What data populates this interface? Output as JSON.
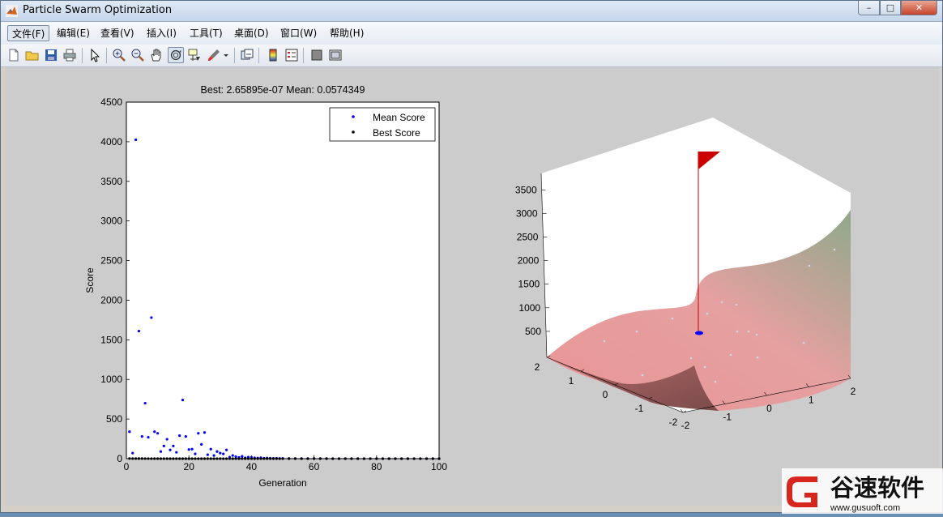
{
  "window": {
    "title": "Particle Swarm Optimization",
    "controls": {
      "minimize": "–",
      "maximize": "□",
      "close": "✕"
    }
  },
  "menubar": {
    "items": [
      {
        "label": "文件(F)"
      },
      {
        "label": "编辑(E)"
      },
      {
        "label": "查看(V)"
      },
      {
        "label": "插入(I)"
      },
      {
        "label": "工具(T)"
      },
      {
        "label": "桌面(D)"
      },
      {
        "label": "窗口(W)"
      },
      {
        "label": "帮助(H)"
      }
    ],
    "dock_icon": "dock-arrow-icon"
  },
  "toolbar": {
    "icons": [
      "new-file-icon",
      "open-folder-icon",
      "save-icon",
      "print-icon",
      "select-arrow-icon",
      "zoom-in-icon",
      "zoom-out-icon",
      "pan-hand-icon",
      "rotate-3d-icon",
      "data-cursor-icon",
      "brush-icon",
      "brush-menu-icon",
      "link-plot-icon",
      "colorbar-icon",
      "legend-icon",
      "hide-plot-tools-icon",
      "show-plot-tools-icon"
    ]
  },
  "chart_data": [
    {
      "type": "scatter",
      "title": "Best: 2.65895e-07 Mean: 0.0574349",
      "xlabel": "Generation",
      "ylabel": "Score",
      "xlim": [
        0,
        100
      ],
      "ylim": [
        0,
        4500
      ],
      "xticks": [
        "0",
        "20",
        "40",
        "60",
        "80",
        "100"
      ],
      "yticks": [
        "0",
        "500",
        "1000",
        "1500",
        "2000",
        "2500",
        "3000",
        "3500",
        "4000",
        "4500"
      ],
      "legend_position": "top-right",
      "series": [
        {
          "name": "Mean Score",
          "color": "#0000ff",
          "x": [
            1,
            2,
            3,
            4,
            5,
            6,
            7,
            8,
            9,
            10,
            11,
            12,
            13,
            14,
            15,
            16,
            17,
            18,
            19,
            20,
            21,
            22,
            23,
            24,
            25,
            26,
            27,
            28,
            29,
            30,
            31,
            32,
            33,
            34,
            35,
            36,
            37,
            38,
            39,
            40,
            41,
            42,
            43,
            44,
            45,
            46,
            47,
            48,
            49,
            50,
            52,
            54,
            56,
            58,
            60,
            62,
            64,
            66,
            68,
            70,
            72,
            74,
            76,
            78,
            80,
            82,
            84,
            86,
            88,
            90,
            92,
            94,
            96,
            98,
            100
          ],
          "y": [
            340,
            70,
            4025,
            1610,
            280,
            700,
            270,
            1780,
            340,
            320,
            90,
            160,
            245,
            110,
            160,
            80,
            290,
            740,
            280,
            115,
            120,
            60,
            320,
            180,
            330,
            50,
            120,
            40,
            90,
            70,
            60,
            110,
            20,
            40,
            25,
            15,
            30,
            10,
            20,
            15,
            10,
            8,
            12,
            6,
            8,
            5,
            4,
            6,
            3,
            4,
            3,
            2,
            2,
            1,
            1,
            1,
            1,
            0.5,
            0.5,
            0.4,
            0.3,
            0.2,
            0.2,
            0.1,
            0.1,
            0.1,
            0.08,
            0.07,
            0.07,
            0.06,
            0.06,
            0.06,
            0.06,
            0.06,
            0.06
          ]
        },
        {
          "name": "Best Score",
          "color": "#000000",
          "x": [
            1,
            2,
            3,
            4,
            5,
            6,
            7,
            8,
            9,
            10,
            11,
            12,
            13,
            14,
            15,
            16,
            17,
            18,
            19,
            20,
            21,
            22,
            23,
            24,
            25,
            26,
            27,
            28,
            29,
            30,
            31,
            32,
            33,
            34,
            35,
            36,
            37,
            38,
            39,
            40,
            41,
            42,
            43,
            44,
            45,
            46,
            47,
            48,
            49,
            50,
            52,
            54,
            56,
            58,
            60,
            62,
            64,
            66,
            68,
            70,
            72,
            74,
            76,
            78,
            80,
            82,
            84,
            86,
            88,
            90,
            92,
            94,
            96,
            98,
            100
          ],
          "y": [
            2,
            1.5,
            1.2,
            1,
            0.9,
            0.8,
            0.7,
            0.6,
            0.5,
            0.4,
            0.3,
            0.25,
            0.2,
            0.15,
            0.12,
            0.1,
            0.08,
            0.06,
            0.05,
            0.04,
            0.03,
            0.02,
            0.015,
            0.01,
            0.008,
            0.006,
            0.005,
            0.004,
            0.003,
            0.002,
            0.0015,
            0.001,
            0.0008,
            0.0006,
            0.0005,
            0.0004,
            0.0003,
            0.0002,
            0.00015,
            0.0001,
            8e-05,
            6e-05,
            5e-05,
            4e-05,
            3e-05,
            2e-05,
            1.5e-05,
            1e-05,
            8e-06,
            6e-06,
            4e-06,
            3e-06,
            2e-06,
            1.5e-06,
            1e-06,
            8e-07,
            6e-07,
            5e-07,
            4e-07,
            3.5e-07,
            3e-07,
            3e-07,
            2.9e-07,
            2.8e-07,
            2.8e-07,
            2.7e-07,
            2.7e-07,
            2.7e-07,
            2.7e-07,
            2.66e-07,
            2.66e-07,
            2.66e-07,
            2.66e-07,
            2.66e-07,
            2.66e-07
          ]
        }
      ]
    },
    {
      "type": "surface",
      "zticks": [
        "500",
        "1000",
        "1500",
        "2000",
        "2500",
        "3000",
        "3500"
      ],
      "xticks": [
        "-2",
        "-1",
        "0",
        "1",
        "2"
      ],
      "yticks": [
        "-1",
        "0",
        "1",
        "2"
      ],
      "zlim": [
        0,
        3900
      ],
      "surface_colors": {
        "low": "#e89a9a",
        "high": "#8fa98a"
      },
      "marker_color": "#cc0000",
      "swarm_color": "#0000ff"
    }
  ],
  "watermark": {
    "brand": "谷速软件",
    "url": "www.gusuoft.com"
  }
}
